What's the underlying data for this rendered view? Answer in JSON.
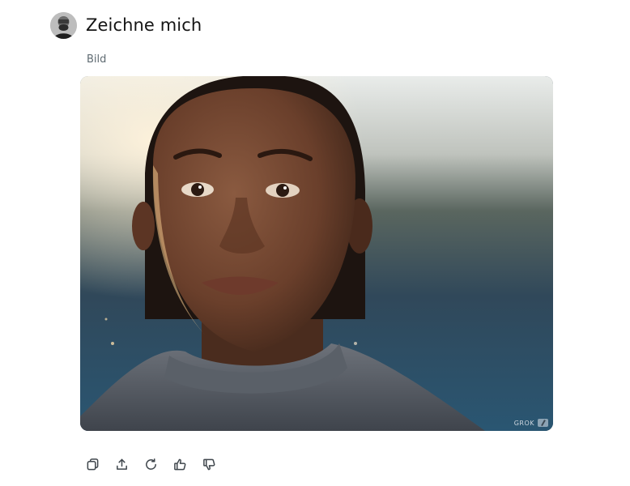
{
  "message": {
    "title": "Zeichne mich",
    "subtitle": "Bild"
  },
  "image": {
    "watermark_text": "GROK",
    "watermark_icon": "grok-edit-icon"
  },
  "actions": [
    {
      "icon": "copy-icon"
    },
    {
      "icon": "share-icon"
    },
    {
      "icon": "regenerate-icon"
    },
    {
      "icon": "thumbs-up-icon"
    },
    {
      "icon": "thumbs-down-icon"
    }
  ]
}
